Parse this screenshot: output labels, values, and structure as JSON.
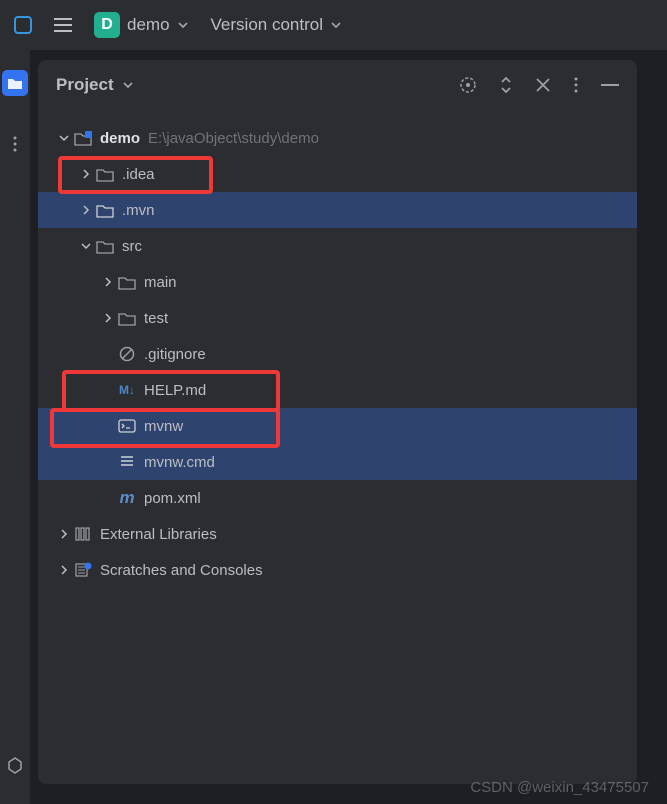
{
  "topbar": {
    "badge_letter": "D",
    "project_name": "demo",
    "menu_label": "Version control"
  },
  "panel": {
    "title": "Project"
  },
  "tree": {
    "root": {
      "name": "demo",
      "path": "E:\\javaObject\\study\\demo"
    },
    "idea": ".idea",
    "mvn": ".mvn",
    "src": "src",
    "main": "main",
    "test": "test",
    "gitignore": ".gitignore",
    "helpmd": "HELP.md",
    "mvnw": "mvnw",
    "mvnwcmd": "mvnw.cmd",
    "pom": "pom.xml",
    "ext_lib": "External Libraries",
    "scratches": "Scratches and Consoles"
  },
  "watermark": "CSDN @weixin_43475507"
}
